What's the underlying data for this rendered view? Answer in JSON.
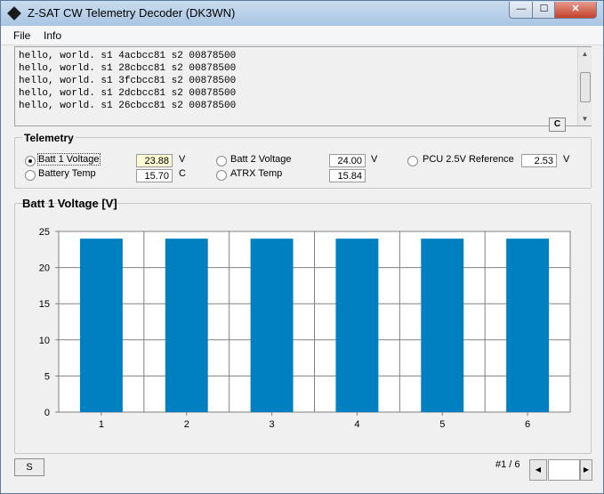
{
  "window": {
    "title": "Z-SAT CW Telemetry Decoder (DK3WN)",
    "min_glyph": "—",
    "max_glyph": "☐",
    "close_glyph": "✕"
  },
  "menu": {
    "file": "File",
    "info": "Info"
  },
  "console": {
    "lines": [
      "hello, world. s1 4acbcc81 s2 00878500",
      "hello, world. s1 28cbcc81 s2 00878500",
      "hello, world. s1 3fcbcc81 s2 00878500",
      "hello, world. s1 2dcbcc81 s2 00878500",
      "hello, world. s1 26cbcc81 s2 00878500"
    ],
    "clear_label": "C",
    "up_glyph": "▲",
    "down_glyph": "▼"
  },
  "telemetry": {
    "group_label": "Telemetry",
    "batt1_label": "Batt 1 Voltage",
    "batt1_value": "23.88",
    "batt1_unit": "V",
    "battery_temp_label": "Battery Temp",
    "battery_temp_value": "15.70",
    "battery_temp_unit": "C",
    "batt2_label": "Batt 2 Voltage",
    "batt2_value": "24.00",
    "batt2_unit": "V",
    "atrx_label": "ATRX Temp",
    "atrx_value": "15.84",
    "pcu_label": "PCU 2.5V Reference",
    "pcu_value": "2.53",
    "pcu_unit": "V",
    "selected": "Batt 1 Voltage"
  },
  "chart_data": {
    "type": "bar",
    "title": "Batt 1 Voltage [V]",
    "categories": [
      "1",
      "2",
      "3",
      "4",
      "5",
      "6"
    ],
    "values": [
      24,
      24,
      24,
      24,
      24,
      24
    ],
    "ylim": [
      0,
      25
    ],
    "yticks": [
      0,
      5,
      10,
      15,
      20,
      25
    ],
    "grid": true,
    "bar_color": "#0080c0"
  },
  "footer": {
    "s_label": "S",
    "page_indicator": "#1 / 6",
    "prev_glyph": "◀",
    "next_glyph": "▶"
  }
}
